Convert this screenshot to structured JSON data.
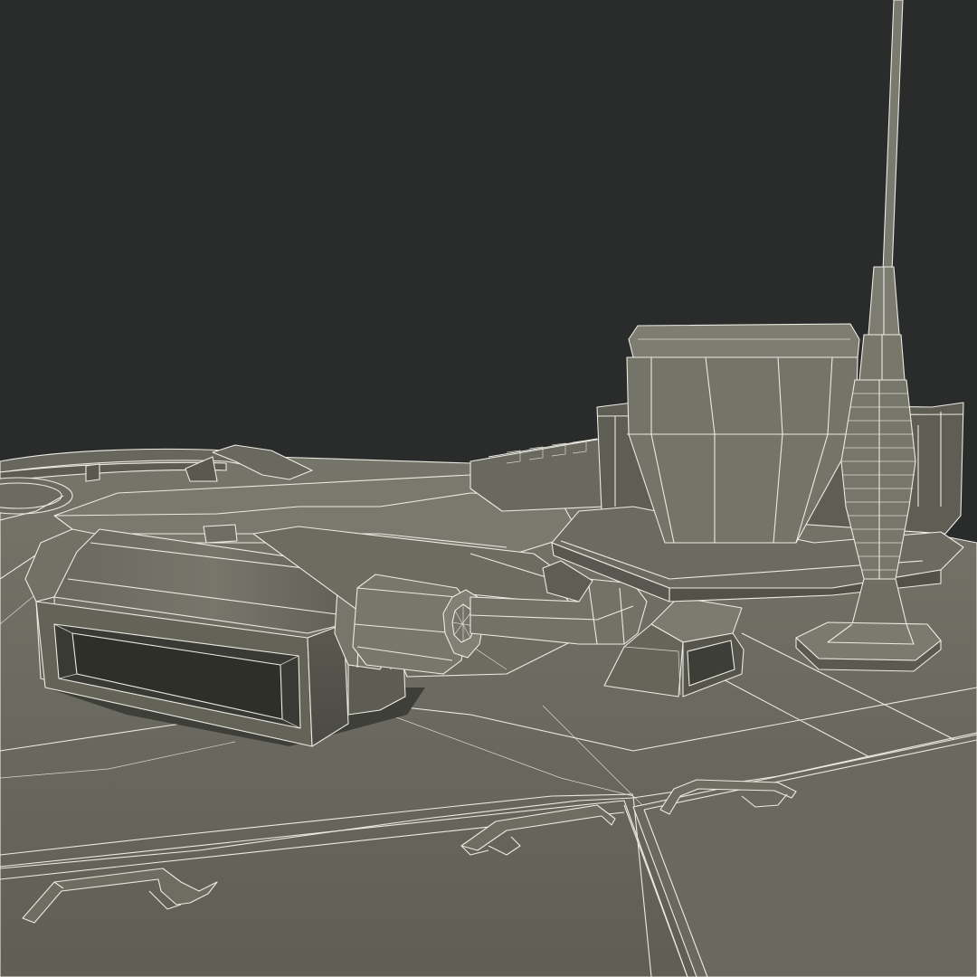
{
  "scene": {
    "subject": "wireframe-3d-render",
    "colors": {
      "background": "#2a2b2b",
      "surface": "#6f6e64",
      "surface_light": "#7e7d72",
      "surface_dark": "#55544b",
      "shadow": "#3c3c36",
      "wire": "#ecebe3"
    }
  }
}
